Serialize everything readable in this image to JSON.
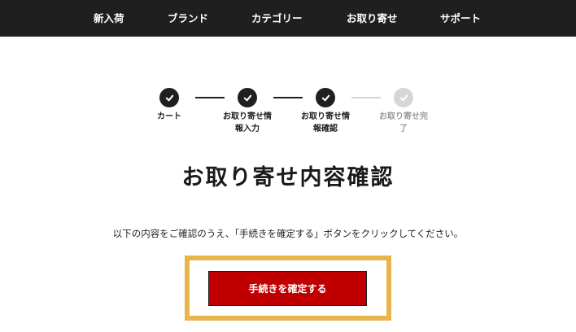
{
  "header": {
    "nav_items": [
      {
        "label": "新入荷"
      },
      {
        "label": "ブランド"
      },
      {
        "label": "カテゴリー"
      },
      {
        "label": "お取り寄せ"
      },
      {
        "label": "サポート"
      }
    ]
  },
  "stepper": {
    "steps": [
      {
        "label_line1": "カート",
        "label_line2": "",
        "state": "completed"
      },
      {
        "label_line1": "お取り寄せ情",
        "label_line2": "報入力",
        "state": "completed"
      },
      {
        "label_line1": "お取り寄せ情",
        "label_line2": "報確認",
        "state": "current"
      },
      {
        "label_line1": "お取り寄せ完",
        "label_line2": "了",
        "state": "pending"
      }
    ],
    "colors": {
      "active": "#1f1f1f",
      "inactive": "#d6d6d6",
      "inactive_text": "#9a9a9a"
    }
  },
  "main": {
    "title": "お取り寄せ内容確認",
    "instruction": "以下の内容をご確認のうえ、「手続きを確定する」ボタンをクリックしてください。",
    "confirm_label": "手続きを確定する"
  },
  "colors": {
    "header_bg": "#1f1f1f",
    "button_bg": "#c00000",
    "highlight": "#e8b54a"
  }
}
